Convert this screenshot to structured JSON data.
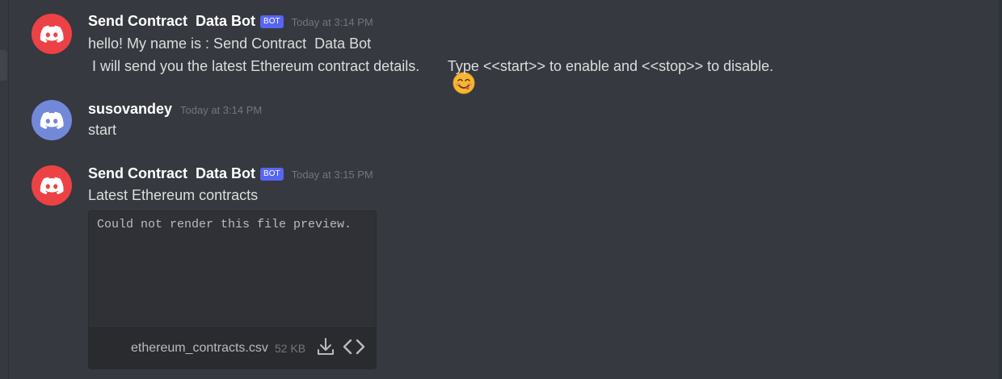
{
  "messages": [
    {
      "username": "Send Contract  Data Bot",
      "bot_tag": "BOT",
      "timestamp": "Today at 3:14 PM",
      "avatar_color": "#ed4245",
      "lines": [
        "hello! My name is : Send Contract  Data Bot",
        " I will send you the latest Ethereum contract details.",
        " Type <<start>> to enable and <<stop>> to disable."
      ],
      "emoji": "face-savoring-food-emoji"
    },
    {
      "username": "susovandey",
      "timestamp": "Today at 3:14 PM",
      "avatar_color": "#7289da",
      "lines": [
        "start"
      ]
    },
    {
      "username": "Send Contract  Data Bot",
      "bot_tag": "BOT",
      "timestamp": "Today at 3:15 PM",
      "avatar_color": "#ed4245",
      "lines": [
        "Latest Ethereum contracts"
      ],
      "attachment": {
        "preview_text": "Could not render this file preview.",
        "filename": "ethereum_contracts.csv",
        "filesize": "52 KB",
        "icons": [
          "download-icon",
          "code-icon"
        ]
      }
    }
  ],
  "colors": {
    "background": "#36393f",
    "bot_tag": "#5865f2",
    "username": "#ffffff",
    "text": "#dcddde",
    "timestamp": "#72767d"
  }
}
